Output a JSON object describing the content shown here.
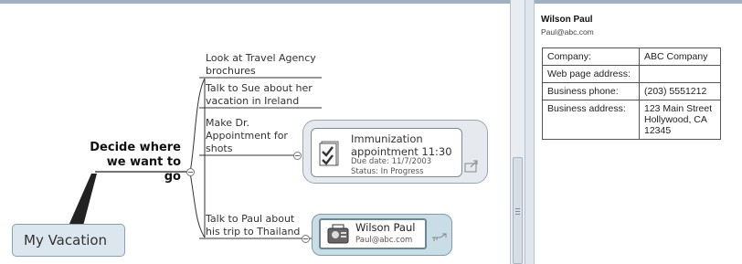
{
  "map": {
    "central_topic": "My Vacation",
    "main_topic": [
      "Decide where",
      "we want to go"
    ],
    "subtopics": [
      [
        "Look at Travel Agency",
        "brochures"
      ],
      [
        "Talk to Sue about her",
        "vacation in Ireland"
      ],
      [
        "Make Dr.",
        "Appointment for",
        "shots"
      ],
      [
        "Talk to Paul about",
        "his trip to Thailand"
      ]
    ],
    "task": {
      "title_line1": "Immunization",
      "title_line2": "appointment 11:30",
      "due": "Due date: 11/7/2003",
      "status": "Status: In Progress",
      "icon": "task-check-icon"
    },
    "contact": {
      "name": "Wilson Paul",
      "email": "Paul@abc.com",
      "icon": "contact-card-icon"
    }
  },
  "details": {
    "name": "Wilson Paul",
    "email": "Paul@abc.com",
    "rows": [
      {
        "label": "Company:",
        "value": "ABC Company"
      },
      {
        "label": "Web page address:",
        "value": ""
      },
      {
        "label": "Business phone:",
        "value": "(203) 5551212"
      },
      {
        "label": "Business address:",
        "value": "123 Main Street Hollywood, CA 12345"
      }
    ]
  },
  "colors": {
    "map_background": "#ffffff",
    "central_fill": "#dbe6ef",
    "contact_frame": "#c9dde7",
    "pane_border": "#9fb0c2"
  }
}
